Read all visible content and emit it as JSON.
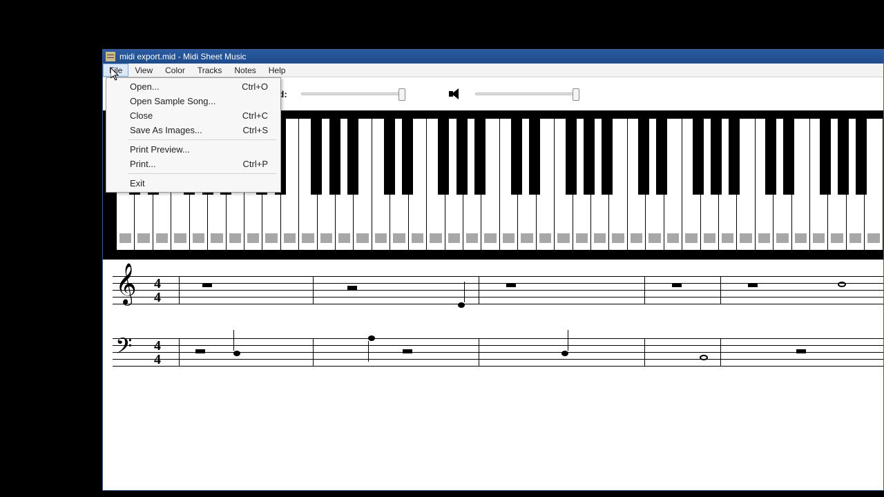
{
  "window": {
    "title": "midi export.mid - Midi Sheet Music"
  },
  "menubar": {
    "items": [
      "File",
      "View",
      "Color",
      "Tracks",
      "Notes",
      "Help"
    ],
    "active_index": 0
  },
  "file_menu": {
    "items": [
      {
        "label": "Open...",
        "shortcut": "Ctrl+O"
      },
      {
        "label": "Open Sample Song...",
        "shortcut": ""
      },
      {
        "label": "Close",
        "shortcut": "Ctrl+C"
      },
      {
        "label": "Save As Images...",
        "shortcut": "Ctrl+S"
      },
      {
        "sep": true
      },
      {
        "label": "Print Preview...",
        "shortcut": ""
      },
      {
        "label": "Print...",
        "shortcut": "Ctrl+P"
      },
      {
        "sep": true
      },
      {
        "label": "Exit",
        "shortcut": ""
      }
    ]
  },
  "toolbar": {
    "speed_label": "peed:",
    "speed_slider": {
      "min": 0,
      "max": 100,
      "value": 100
    },
    "volume_slider": {
      "min": 0,
      "max": 100,
      "value": 100
    }
  },
  "piano": {
    "white_key_count": 42
  },
  "sheet": {
    "time_signature_top": "4",
    "time_signature_bottom": "4"
  }
}
